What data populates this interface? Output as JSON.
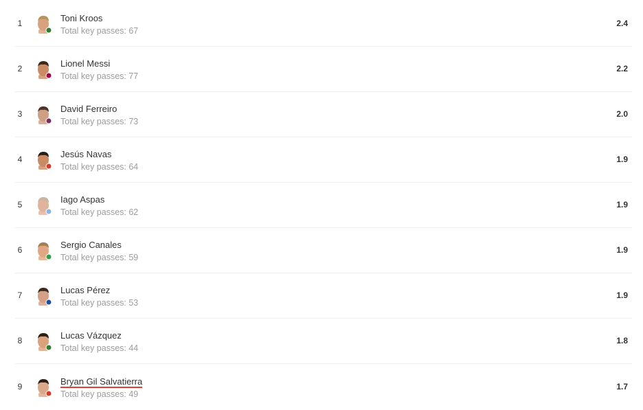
{
  "players": [
    {
      "rank": "1",
      "name": "Toni Kroos",
      "subtitle": "Total key passes: 67",
      "rating": "2.4",
      "skin": "#d9a27e",
      "hair": "#b9925c",
      "badge": "#2e7d32"
    },
    {
      "rank": "2",
      "name": "Lionel Messi",
      "subtitle": "Total key passes: 77",
      "rating": "2.2",
      "skin": "#c98a64",
      "hair": "#3a2a1e",
      "badge": "#a50044"
    },
    {
      "rank": "3",
      "name": "David Ferreiro",
      "subtitle": "Total key passes: 73",
      "rating": "2.0",
      "skin": "#cf9f84",
      "hair": "#4a3528",
      "badge": "#7b2d5f"
    },
    {
      "rank": "4",
      "name": "Jesús Navas",
      "subtitle": "Total key passes: 64",
      "rating": "1.9",
      "skin": "#c98a64",
      "hair": "#2b1e16",
      "badge": "#d33b2c"
    },
    {
      "rank": "5",
      "name": "Iago Aspas",
      "subtitle": "Total key passes: 62",
      "rating": "1.9",
      "skin": "#e0b49c",
      "hair": "#c8b5a2",
      "badge": "#8ab4e0"
    },
    {
      "rank": "6",
      "name": "Sergio Canales",
      "subtitle": "Total key passes: 59",
      "rating": "1.9",
      "skin": "#e0a882",
      "hair": "#a67c52",
      "badge": "#2e9e4a"
    },
    {
      "rank": "7",
      "name": "Lucas Pérez",
      "subtitle": "Total key passes: 53",
      "rating": "1.9",
      "skin": "#d4a088",
      "hair": "#3a2a1e",
      "badge": "#1f4fa0"
    },
    {
      "rank": "8",
      "name": "Lucas Vázquez",
      "subtitle": "Total key passes: 44",
      "rating": "1.8",
      "skin": "#d9a27e",
      "hair": "#2b1e16",
      "badge": "#2e7d32"
    },
    {
      "rank": "9",
      "name": "Bryan Gil Salvatierra",
      "subtitle": "Total key passes: 49",
      "rating": "1.7",
      "skin": "#dca88a",
      "hair": "#2b1e16",
      "badge": "#d33b2c"
    }
  ]
}
